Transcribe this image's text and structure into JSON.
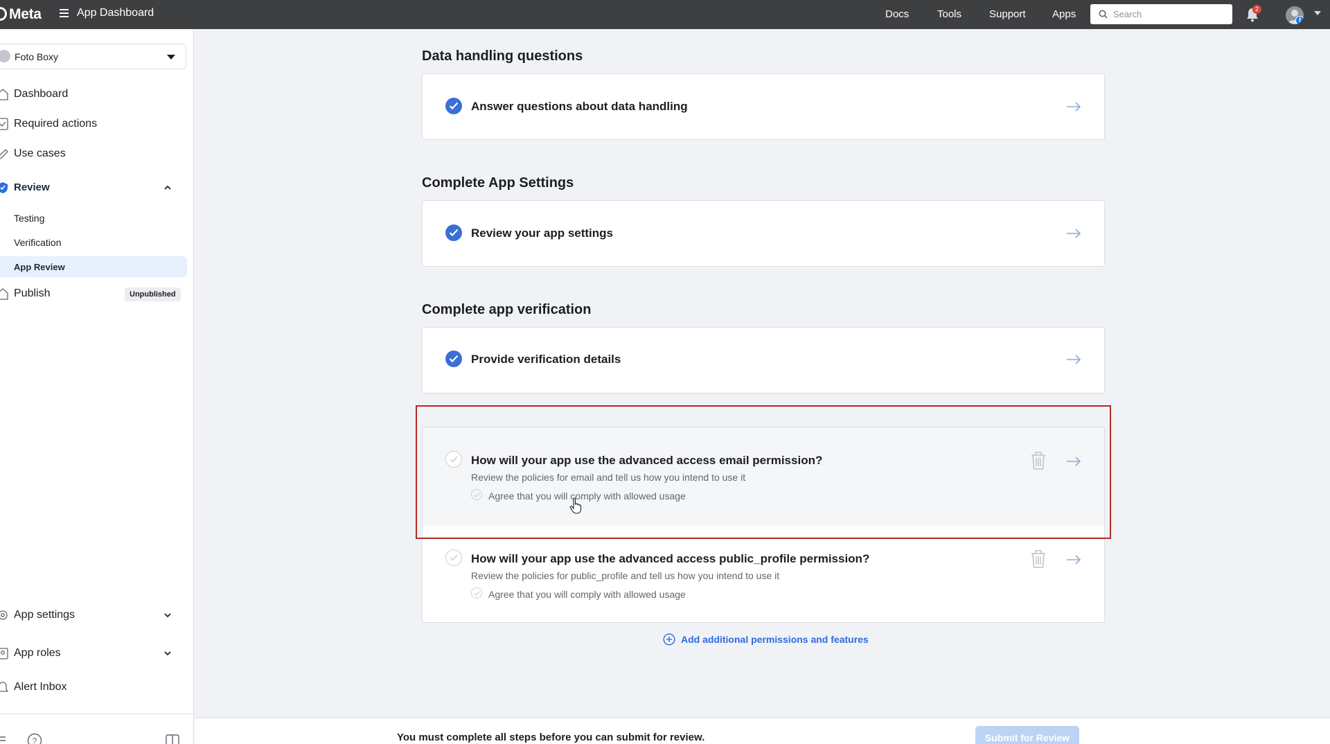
{
  "topbar": {
    "logo": "Meta",
    "app_title": "App Dashboard",
    "links": [
      "Docs",
      "Tools",
      "Support",
      "Apps"
    ],
    "search_placeholder": "Search",
    "notification_count": "2"
  },
  "sidebar": {
    "app_name": "Foto Boxy",
    "items": {
      "dashboard": "Dashboard",
      "required_actions": "Required actions",
      "use_cases": "Use cases",
      "review": "Review",
      "testing": "Testing",
      "verification": "Verification",
      "app_review": "App Review",
      "publish": "Publish",
      "publish_badge": "Unpublished",
      "app_settings": "App settings",
      "app_roles": "App roles",
      "alert_inbox": "Alert Inbox"
    }
  },
  "main": {
    "sections": [
      {
        "title": "Data handling questions",
        "row": "Answer questions about data handling"
      },
      {
        "title": "Complete App Settings",
        "row": "Review your app settings"
      },
      {
        "title": "Complete app verification",
        "row": "Provide verification details"
      }
    ],
    "permissions": [
      {
        "title": "How will your app use the advanced access email permission?",
        "desc": "Review the policies for email and tell us how you intend to use it",
        "agree": "Agree that you will comply with allowed usage"
      },
      {
        "title": "How will your app use the advanced access public_profile permission?",
        "desc": "Review the policies for public_profile and tell us how you intend to use it",
        "agree": "Agree that you will comply with allowed usage"
      }
    ],
    "add_link": "Add additional permissions and features"
  },
  "footer": {
    "message": "You must complete all steps before you can submit for review.",
    "submit_label": "Submit for Review"
  },
  "colors": {
    "accent": "#3b6fd4",
    "highlight_border": "#b22b26",
    "topbar": "#3e3f41",
    "submit_disabled": "#bcd3f5"
  }
}
